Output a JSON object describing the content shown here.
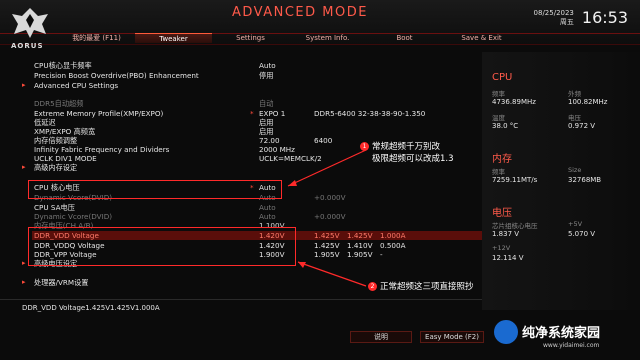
{
  "header": {
    "title": "ADVANCED MODE",
    "logo_text": "AORUS",
    "date": "08/25/2023",
    "weekday": "周五",
    "time": "16:53",
    "tabs": [
      {
        "label": "我的最爱 (F11)",
        "active": false
      },
      {
        "label": "Tweaker",
        "active": true
      },
      {
        "label": "Settings",
        "active": false
      },
      {
        "label": "System Info.",
        "active": false
      },
      {
        "label": "Boot",
        "active": false
      },
      {
        "label": "Save & Exit",
        "active": false
      }
    ]
  },
  "settings": [
    {
      "label": "CPU核心显卡频率",
      "value": "Auto"
    },
    {
      "label": "Precision Boost Overdrive(PBO) Enhancement",
      "value": "停用"
    },
    {
      "label": "Advanced CPU Settings"
    },
    {
      "label": "DDR5自动超频",
      "value": "自动"
    },
    {
      "label": "Extreme Memory Profile(XMP/EXPO)",
      "value": "EXPO 1",
      "extra": "DDR5-6400 32-38-38-90-1.350"
    },
    {
      "label": "低延迟",
      "value": "启用"
    },
    {
      "label": "XMP/EXPO 高频宽",
      "value": "启用"
    },
    {
      "label": "内存倍频调整",
      "value": "72.00",
      "extra": "6400"
    },
    {
      "label": "Infinity Fabric Frequency and Dividers",
      "value": "2000 MHz"
    },
    {
      "label": "UCLK DIV1 MODE",
      "value": "UCLK=MEMCLK/2"
    },
    {
      "label": "高级内存设定"
    },
    {
      "label": "CPU 核心电压",
      "value": "Auto"
    },
    {
      "label": "Dynamic Vcore(DVID)",
      "value": "Auto",
      "extra": "+0.000V"
    },
    {
      "label": "CPU SA电压",
      "value": "Auto"
    },
    {
      "label": "Dynamic Vcore(DVID)",
      "value": "Auto",
      "extra": "+0.000V"
    },
    {
      "label": "内存电压(CH A/B)",
      "value": "1.100V"
    },
    {
      "label": "DDR_VDD Voltage",
      "value": "1.420V",
      "c2": "1.425V",
      "c3": "1.425V",
      "c4": "1.000A"
    },
    {
      "label": "DDR_VDDQ Voltage",
      "value": "1.420V",
      "c2": "1.425V",
      "c3": "1.410V",
      "c4": "0.500A"
    },
    {
      "label": "DDR_VPP Voltage",
      "value": "1.900V",
      "c2": "1.905V",
      "c3": "1.905V",
      "c4": "-"
    },
    {
      "label": "高级电压设定"
    },
    {
      "label": "处理器/VRM设置"
    }
  ],
  "status_text": "DDR_VDD Voltage1.425V1.425V1.000A",
  "side": {
    "cpu": {
      "title": "CPU",
      "freq_label": "频率",
      "freq": "4736.89MHz",
      "bclk_label": "外频",
      "bclk": "100.82MHz",
      "temp_label": "温度",
      "temp": "38.0 °C",
      "volt_label": "电压",
      "volt": "0.972 V"
    },
    "memory": {
      "title": "内存",
      "freq_label": "频率",
      "freq": "7259.11MT/s",
      "size_label": "Size",
      "size": "32768MB"
    },
    "voltage": {
      "title": "电压",
      "v1_label": "芯片组核心电压",
      "v1": "1.837 V",
      "v2_label": "+5V",
      "v2": "5.070 V",
      "v3_label": "+12V",
      "v3": "12.114 V"
    }
  },
  "annotations": {
    "a1_num": "1",
    "a1_line1": "常规超频千万别改",
    "a1_line2": "极限超频可以改成1.3",
    "a2_num": "2",
    "a2_text": "正常超频这三项直接照抄"
  },
  "footer": {
    "explain": "说明",
    "easy_mode": "Easy Mode (F2)"
  },
  "watermark": {
    "name": "纯净系统家园",
    "url": "www.yidaimei.com"
  },
  "colors": {
    "accent": "#ff5a4a",
    "highlight_row": "#5a0e0a",
    "annotation_box": "#ff2a2a"
  }
}
